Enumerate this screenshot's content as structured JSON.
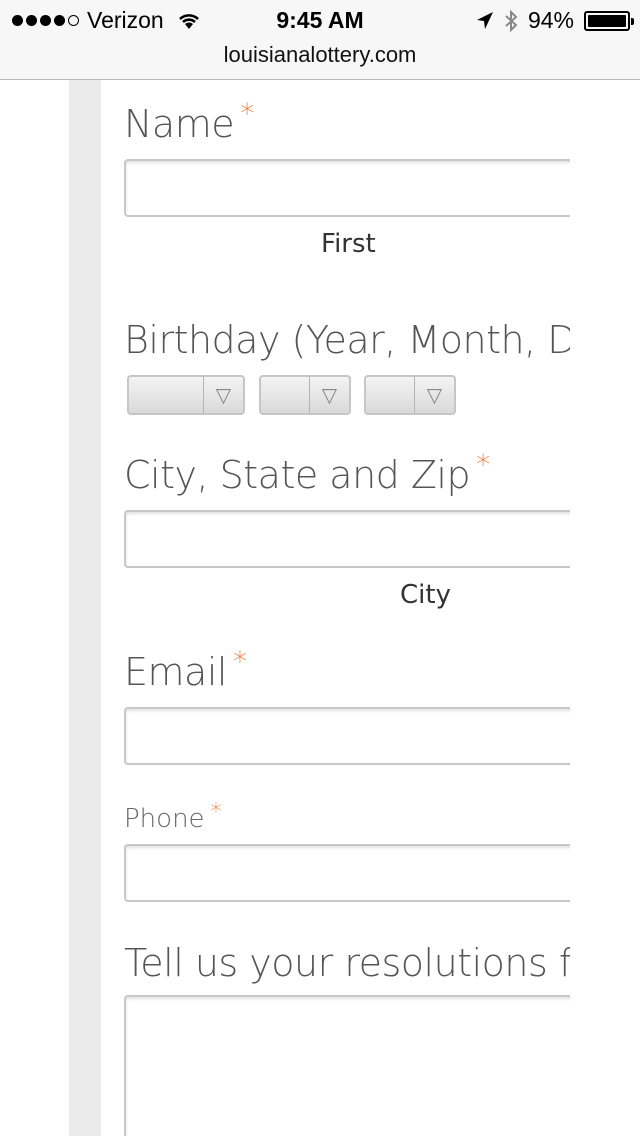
{
  "status_bar": {
    "carrier": "Verizon",
    "time": "9:45 AM",
    "battery": "94%",
    "signal_bars": 4
  },
  "browser": {
    "url": "louisianalottery.com"
  },
  "form": {
    "name_label": "Name",
    "name_sub_first": "First",
    "birthday_label": "Birthday (Year, Month, Day)",
    "city_label": "City, State and Zip",
    "city_sub": "City",
    "email_label": "Email",
    "phone_label": "Phone",
    "resolutions_label": "Tell us your resolutions for",
    "required_mark": "*",
    "select_arrow": "▽"
  },
  "colors": {
    "required": "#f26b21",
    "label": "#555555"
  }
}
